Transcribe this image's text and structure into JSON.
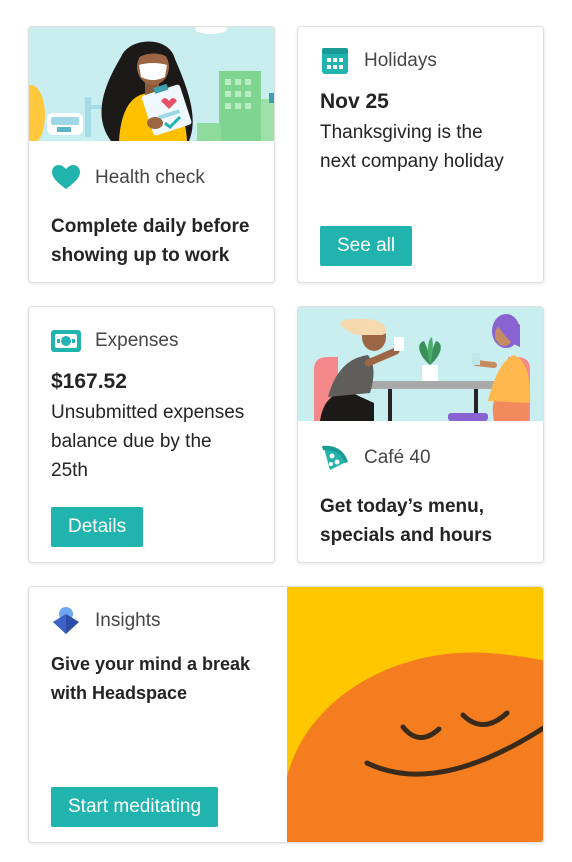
{
  "health": {
    "label": "Health check",
    "text": "Complete daily before showing up to work"
  },
  "holidays": {
    "label": "Holidays",
    "date": "Nov 25",
    "text": "Thanksgiving is the next company holiday",
    "button": "See all"
  },
  "expenses": {
    "label": "Expenses",
    "amount": "$167.52",
    "text": "Unsubmitted expenses balance due by the 25th",
    "button": "Details"
  },
  "cafe": {
    "label": "Café 40",
    "text": "Get today’s menu, specials and hours"
  },
  "insights": {
    "label": "Insights",
    "text": "Give your mind a break with Headspace",
    "button": "Start meditating"
  },
  "colors": {
    "accent": "#21b3ad",
    "headspace_orange": "#f47d20",
    "headspace_yellow": "#ffc700"
  },
  "icons": {
    "health": "heart-icon",
    "holidays": "calendar-icon",
    "expenses": "money-icon",
    "cafe": "pizza-icon",
    "insights": "insights-logo-icon"
  }
}
